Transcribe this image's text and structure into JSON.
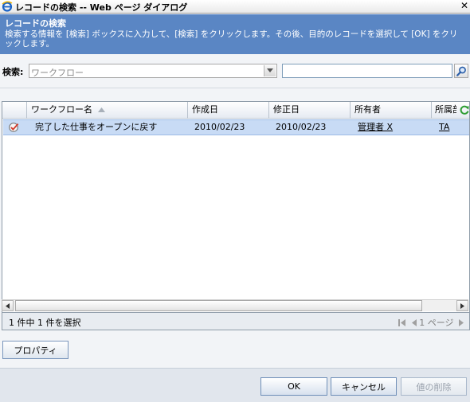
{
  "window": {
    "title": "レコードの検索 -- Web ページ ダイアログ",
    "close_glyph": "✕"
  },
  "header": {
    "title": "レコードの検索",
    "description": "検索する情報を [検索] ボックスに入力して、[検索] をクリックします。その後、目的のレコードを選択して [OK] をクリックします。"
  },
  "search": {
    "label": "検索:",
    "entity_selected": "ワークフロー",
    "input_value": "",
    "button_icon": "search-icon"
  },
  "grid": {
    "columns": [
      {
        "label": "ワークフロー名",
        "sorted": "ascending"
      },
      {
        "label": "作成日"
      },
      {
        "label": "修正日"
      },
      {
        "label": "所有者"
      },
      {
        "label": "所属部"
      }
    ],
    "rows": [
      {
        "icon": "workflow-icon",
        "name": "完了した仕事をオープンに戻す",
        "created": "2010/02/23",
        "modified": "2010/02/23",
        "owner": "管理者 X",
        "business_unit": "TA",
        "selected": true
      }
    ]
  },
  "status": {
    "selection_text": "1 件中 1 件を選択",
    "page_text": "1 ページ"
  },
  "buttons": {
    "properties": "プロパティ",
    "ok": "OK",
    "cancel": "キャンセル",
    "remove_value": "値の削除"
  },
  "colors": {
    "header_bg": "#5a86c4",
    "selected_row_bg": "#c8dbf5"
  }
}
